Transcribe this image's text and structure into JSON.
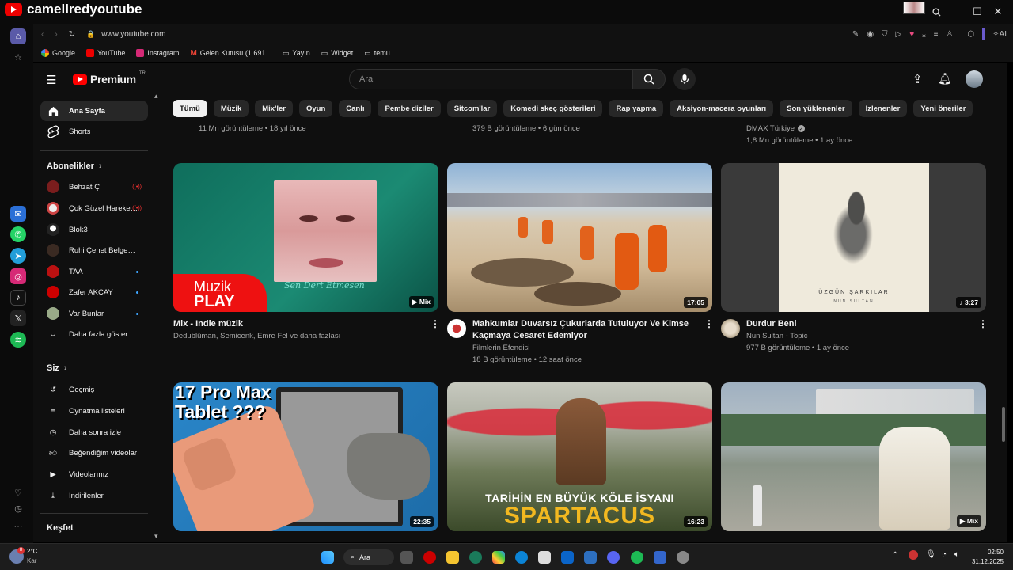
{
  "overlay": {
    "channel_name": "camellredyoutube"
  },
  "browser": {
    "url": "www.youtube.com",
    "ai_label": "AI",
    "bookmarks": [
      "Google",
      "YouTube",
      "Instagram",
      "Gelen Kutusu (1.691...",
      "Yayın",
      "Widget",
      "temu"
    ]
  },
  "yt": {
    "logo_text": "Premium",
    "logo_sup": "TR",
    "search_placeholder": "Ara",
    "guide": {
      "main": [
        {
          "label": "Ana Sayfa"
        },
        {
          "label": "Shorts"
        }
      ],
      "subs_header": "Abonelikler",
      "subs": [
        {
          "label": "Behzat Ç.",
          "badge": "((•))",
          "color": "#7a1d1d"
        },
        {
          "label": "Çok Güzel Hareket...",
          "badge": "((•))",
          "color": "#c44"
        },
        {
          "label": "Blok3",
          "badge": "",
          "color": "#bbb"
        },
        {
          "label": "Ruhi Çenet Belgeseller",
          "badge": "",
          "color": "#3a2a22"
        },
        {
          "label": "TAA",
          "badge": "dot",
          "color": "#b11"
        },
        {
          "label": "Zafer AKCAY",
          "badge": "dot",
          "color": "#c00"
        },
        {
          "label": "Var Bunlar",
          "badge": "dot",
          "color": "#9a8"
        }
      ],
      "show_more": "Daha fazla göster",
      "you_header": "Siz",
      "you": [
        {
          "label": "Geçmiş"
        },
        {
          "label": "Oynatma listeleri"
        },
        {
          "label": "Daha sonra izle"
        },
        {
          "label": "Beğendiğim videolar"
        },
        {
          "label": "Videolarınız"
        },
        {
          "label": "İndirilenler"
        }
      ],
      "explore_header": "Keşfet"
    },
    "chips": [
      "Tümü",
      "Müzik",
      "Mix'ler",
      "Oyun",
      "Canlı",
      "Pembe diziler",
      "Sitcom'lar",
      "Komedi skeç gösterileri",
      "Rap yapma",
      "Aksiyon-macera oyunları",
      "Son yüklenenler",
      "İzlenenler",
      "Yeni öneriler"
    ],
    "row0": [
      {
        "meta": "11 Mn görüntüleme • 18 yıl önce"
      },
      {
        "meta": "379 B görüntüleme • 6 gün önce"
      },
      {
        "channel": "DMAX Türkiye",
        "meta": "1,8 Mn görüntüleme • 1 ay önce"
      }
    ],
    "row1": [
      {
        "title": "Mix - Indie müzik",
        "channel": "Dedublüman, Semicenk, Emre Fel ve daha fazlası",
        "meta": "",
        "duration": "Mix",
        "thumb_text1": "Muzik",
        "thumb_text2": "PLAY",
        "thumb_text3": "Sen Dert Etmesen"
      },
      {
        "title": "Mahkumlar Duvarsız Çukurlarda Tutuluyor Ve Kimse Kaçmaya Cesaret Edemiyor",
        "channel": "Filmlerin Efendisi",
        "meta": "18 B görüntüleme • 12 saat önce",
        "duration": "17:05"
      },
      {
        "title": "Durdur Beni",
        "channel": "Nun Sultan - Topic",
        "meta": "977 B görüntüleme • 1 ay önce",
        "duration": "3:27",
        "thumb_text1": "ÜZGÜN ŞARKILAR",
        "thumb_text2": "NUN SULTAN"
      }
    ],
    "row2": [
      {
        "duration": "22:35",
        "thumb_text": "17 Pro Max Tablet ???"
      },
      {
        "duration": "16:23",
        "thumb_text1": "TARİHİN EN BÜYÜK KÖLE İSYANI",
        "thumb_text2": "SPARTACUS"
      },
      {
        "duration": "Mix"
      }
    ]
  },
  "taskbar": {
    "weather_temp": "2°C",
    "weather_desc": "Kar",
    "search": "Ara",
    "time": "02:50",
    "date": "31.12.2025",
    "badge": "8"
  }
}
